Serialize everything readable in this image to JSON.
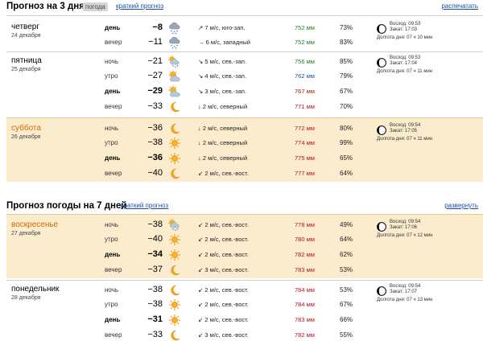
{
  "header3": {
    "title": "Прогноз на 3 дня",
    "chip": "погода",
    "short_link": "краткий прогноз",
    "expand_link": "распечатать"
  },
  "header7": {
    "title": "Прогноз погоды на 7 дней",
    "short_link": "краткий прогноз",
    "expand_link": "развернуть"
  },
  "days": [
    {
      "name": "четверг",
      "date": "24 декабря",
      "weekend": false,
      "sun": {
        "rise": "Восход: 09:53",
        "set": "Закат: 17:03",
        "len": "Долгота дня: 07 ч 10 мин"
      },
      "rows": [
        {
          "tod": "день",
          "bold": true,
          "temp": "−8",
          "icon": "snow-cloud-icon",
          "arrow": "↗",
          "wind": "7 м/с, юго-зап.",
          "press": "752 мм",
          "pc": "g",
          "hum": "73%"
        },
        {
          "tod": "вечер",
          "bold": false,
          "temp": "−11",
          "icon": "snow-cloud-icon",
          "arrow": "→",
          "wind": "6 м/с, западный",
          "press": "752 мм",
          "pc": "g",
          "hum": "83%"
        }
      ]
    },
    {
      "name": "пятница",
      "date": "25 декабря",
      "weekend": false,
      "sun": {
        "rise": "Восход: 09:53",
        "set": "Закат: 17:04",
        "len": "Долгота дня: 07 ч 11 мин"
      },
      "rows": [
        {
          "tod": "ночь",
          "bold": false,
          "temp": "−21",
          "icon": "sun-cloud-snow-icon",
          "arrow": "↘",
          "wind": "5 м/с, сев.-зап.",
          "press": "756 мм",
          "pc": "g",
          "hum": "85%"
        },
        {
          "tod": "утро",
          "bold": false,
          "temp": "−27",
          "icon": "sun-cloud-icon",
          "arrow": "↘",
          "wind": "4 м/с, сев.-зап.",
          "press": "762 мм",
          "pc": "b",
          "hum": "79%"
        },
        {
          "tod": "день",
          "bold": true,
          "temp": "−29",
          "icon": "sun-cloud-icon",
          "arrow": "↘",
          "wind": "3 м/с, сев.-зап.",
          "press": "767 мм",
          "pc": "r",
          "hum": "67%"
        },
        {
          "tod": "вечер",
          "bold": false,
          "temp": "−33",
          "icon": "moon-icon",
          "arrow": "↓",
          "wind": "2 м/с, северный",
          "press": "771 мм",
          "pc": "r",
          "hum": "70%"
        }
      ]
    },
    {
      "name": "суббота",
      "date": "26 декабря",
      "weekend": true,
      "sun": {
        "rise": "Восход: 09:54",
        "set": "Закат: 17:05",
        "len": "Долгота дня: 07 ч 11 мин"
      },
      "rows": [
        {
          "tod": "ночь",
          "bold": false,
          "temp": "−36",
          "icon": "moon-icon",
          "arrow": "↓",
          "wind": "2 м/с, северный",
          "press": "772 мм",
          "pc": "r",
          "hum": "80%"
        },
        {
          "tod": "утро",
          "bold": false,
          "temp": "−38",
          "icon": "sun-icon",
          "arrow": "↓",
          "wind": "2 м/с, северный",
          "press": "774 мм",
          "pc": "r",
          "hum": "99%"
        },
        {
          "tod": "день",
          "bold": true,
          "temp": "−36",
          "icon": "sun-icon",
          "arrow": "↓",
          "wind": "2 м/с, северный",
          "press": "775 мм",
          "pc": "r",
          "hum": "65%"
        },
        {
          "tod": "вечер",
          "bold": false,
          "temp": "−40",
          "icon": "moon-icon",
          "arrow": "↙",
          "wind": "2 м/с, сев.-вост.",
          "press": "777 мм",
          "pc": "r",
          "hum": "64%"
        }
      ]
    },
    {
      "name": "воскресенье",
      "date": "27 декабря",
      "weekend": true,
      "sun": {
        "rise": "Восход: 09:54",
        "set": "Закат: 17:06",
        "len": "Долгота дня: 07 ч 12 мин"
      },
      "rows": [
        {
          "tod": "ночь",
          "bold": false,
          "temp": "−38",
          "icon": "sun-cloud-snow-icon",
          "arrow": "↙",
          "wind": "2 м/с, сев.-вост.",
          "press": "778 мм",
          "pc": "r",
          "hum": "49%"
        },
        {
          "tod": "утро",
          "bold": false,
          "temp": "−40",
          "icon": "sun-icon",
          "arrow": "↙",
          "wind": "2 м/с, сев.-вост.",
          "press": "780 мм",
          "pc": "r",
          "hum": "64%"
        },
        {
          "tod": "день",
          "bold": true,
          "temp": "−34",
          "icon": "sun-icon",
          "arrow": "↙",
          "wind": "2 м/с, сев.-вост.",
          "press": "782 мм",
          "pc": "r",
          "hum": "62%"
        },
        {
          "tod": "вечер",
          "bold": false,
          "temp": "−37",
          "icon": "moon-icon",
          "arrow": "↙",
          "wind": "3 м/с, сев.-вост.",
          "press": "783 мм",
          "pc": "r",
          "hum": "53%"
        }
      ]
    },
    {
      "name": "понедельник",
      "date": "28 декабря",
      "weekend": false,
      "sun": {
        "rise": "Восход: 09:54",
        "set": "Закат: 17:07",
        "len": "Долгота дня: 07 ч 13 мин"
      },
      "rows": [
        {
          "tod": "ночь",
          "bold": false,
          "temp": "−38",
          "icon": "moon-icon",
          "arrow": "↙",
          "wind": "2 м/с, сев.-вост.",
          "press": "784 мм",
          "pc": "r",
          "hum": "53%"
        },
        {
          "tod": "утро",
          "bold": false,
          "temp": "−38",
          "icon": "sun-icon",
          "arrow": "↙",
          "wind": "2 м/с, сев.-вост.",
          "press": "784 мм",
          "pc": "r",
          "hum": "67%"
        },
        {
          "tod": "день",
          "bold": true,
          "temp": "−31",
          "icon": "sun-icon",
          "arrow": "↙",
          "wind": "2 м/с, сев.-вост.",
          "press": "783 мм",
          "pc": "r",
          "hum": "66%"
        },
        {
          "tod": "вечер",
          "bold": false,
          "temp": "−33",
          "icon": "moon-icon",
          "arrow": "↙",
          "wind": "3 м/с, сев.-вост.",
          "press": "782 мм",
          "pc": "r",
          "hum": "55%"
        }
      ]
    }
  ],
  "colors": {
    "weekend_bg": "#fbecce",
    "weekend_name": "#d16a00",
    "link": "#1b4b9c",
    "pressure_normal": "#1f7a2e",
    "pressure_high": "#b3101b",
    "pressure_low": "#1b4b9c",
    "sun": "#f29b0c"
  }
}
